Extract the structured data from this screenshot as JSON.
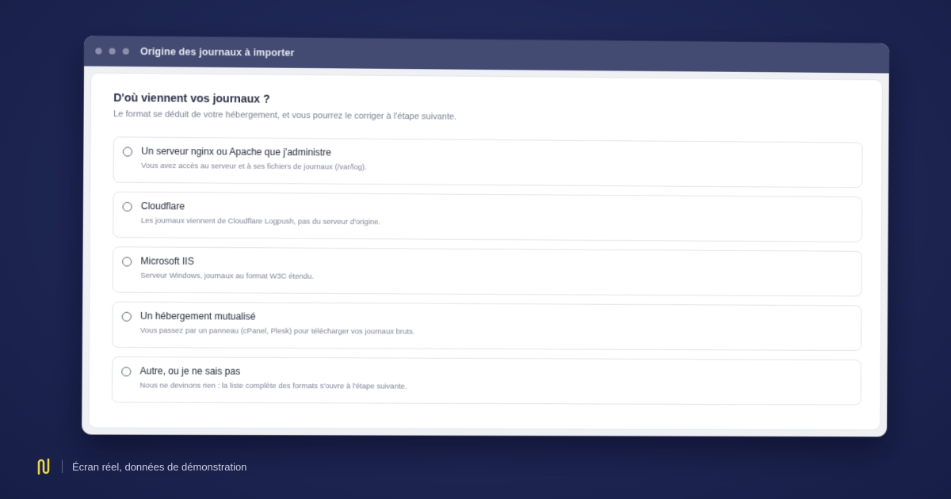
{
  "window": {
    "title": "Origine des journaux à importer"
  },
  "form": {
    "question": "D'où viennent vos journaux ?",
    "hint": "Le format se déduit de votre hébergement, et vous pourrez le corriger à l'étape suivante.",
    "options": [
      {
        "label": "Un serveur nginx ou Apache que j'administre",
        "description": "Vous avez accès au serveur et à ses fichiers de journaux (/var/log)."
      },
      {
        "label": "Cloudflare",
        "description": "Les journaux viennent de Cloudflare Logpush, pas du serveur d'origine."
      },
      {
        "label": "Microsoft IIS",
        "description": "Serveur Windows, journaux au format W3C étendu."
      },
      {
        "label": "Un hébergement mutualisé",
        "description": "Vous passez par un panneau (cPanel, Plesk) pour télécharger vos journaux bruts."
      },
      {
        "label": "Autre, ou je ne sais pas",
        "description": "Nous ne devinons rien : la liste complète des formats s'ouvre à l'étape suivante."
      }
    ]
  },
  "footer": {
    "caption": "Écran réel, données de démonstration"
  },
  "colors": {
    "background": "#1f2756",
    "titlebar": "#434b72",
    "logo": "#e8d44d"
  },
  "icons": {
    "logo": "brand-logo-icon",
    "radio": "radio-unchecked-icon"
  }
}
